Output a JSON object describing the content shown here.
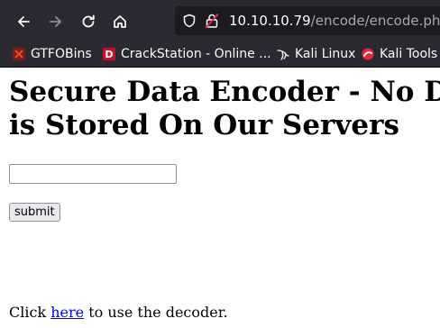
{
  "browser": {
    "address": {
      "host": "10.10.10.79",
      "path": "/encode/encode.php"
    },
    "bookmarks": [
      {
        "label": "GTFOBins",
        "icon": "gtfobins-icon"
      },
      {
        "label": "CrackStation - Online ...",
        "icon": "crackstation-icon"
      },
      {
        "label": "Kali Linux",
        "icon": "kali-dragon-icon"
      },
      {
        "label": "Kali Tools",
        "icon": "kali-tools-icon"
      }
    ]
  },
  "page": {
    "heading": "Secure Data Encoder - No Data is Stored On Our Servers",
    "input": {
      "value": "",
      "placeholder": ""
    },
    "submit_label": "submit",
    "footer": {
      "prefix": "Click ",
      "link": "here",
      "suffix": " to use the decoder."
    }
  }
}
